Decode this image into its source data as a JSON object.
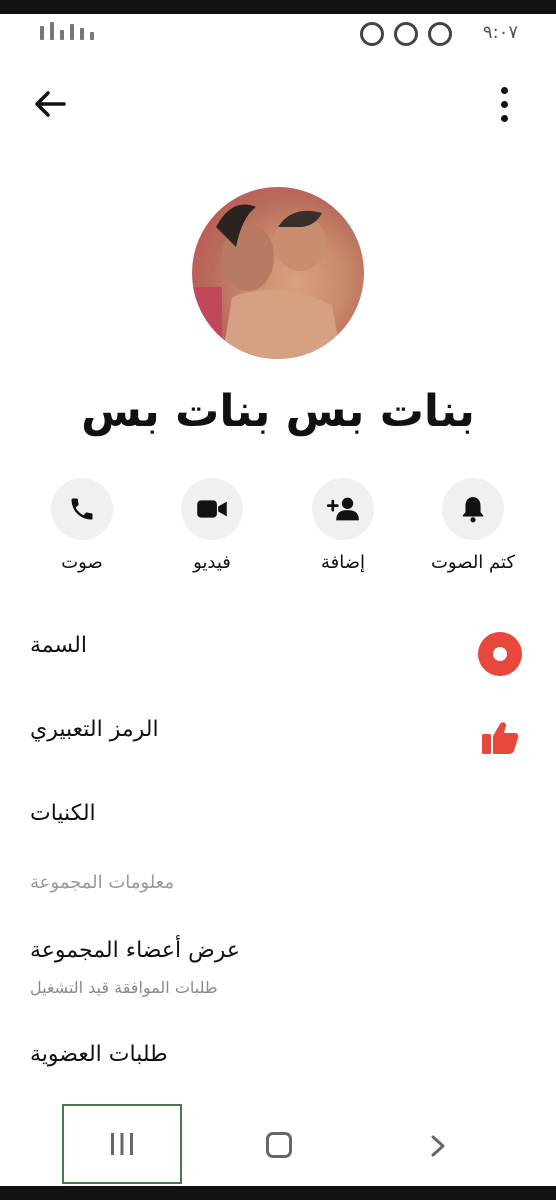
{
  "status_bar": {
    "time": "٩:٠٧"
  },
  "header": {
    "back_icon": "arrow-left-icon",
    "more_icon": "more-vertical-icon"
  },
  "group": {
    "name": "بنات بس بنات بس"
  },
  "actions": [
    {
      "label": "صوت",
      "icon": "phone-icon"
    },
    {
      "label": "فيديو",
      "icon": "video-camera-icon"
    },
    {
      "label": "إضافة",
      "icon": "add-person-icon"
    },
    {
      "label": "كتم الصوت",
      "icon": "bell-icon"
    }
  ],
  "settings": {
    "theme_label": "السمة",
    "theme_color": "#e8473c",
    "emoji_label": "الرمز التعبيري",
    "emoji_color": "#e8473c",
    "nicknames_label": "الكنيات",
    "group_info_heading": "معلومات المجموعة",
    "view_members_label": "عرض أعضاء المجموعة",
    "view_members_sub": "طلبات الموافقة قيد التشغيل",
    "membership_requests_label": "طلبات العضوية"
  },
  "nav": {
    "recents_icon": "recents-icon",
    "home_icon": "home-icon",
    "back_icon": "back-chevron-icon"
  }
}
